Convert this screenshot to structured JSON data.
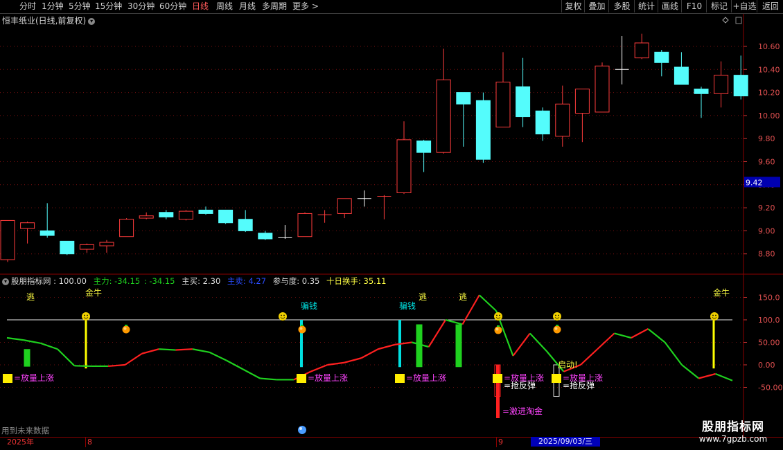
{
  "toolbar": {
    "left": [
      "分时",
      "1分钟",
      "5分钟",
      "15分钟",
      "30分钟",
      "60分钟",
      "日线",
      "周线",
      "月线",
      "多周期",
      "更多"
    ],
    "active": "日线",
    "more_arrow": ">",
    "right": [
      "复权",
      "叠加",
      "多股",
      "统计",
      "画线",
      "F10",
      "标记",
      "+自选",
      "返回"
    ]
  },
  "window": {
    "title": "恒丰纸业(日线,前复权)",
    "dropdown_icon": "chevron-down-icon",
    "diamond_icon": "diamond-icon"
  },
  "price_axis": {
    "ticks": [
      "10.60",
      "10.40",
      "10.20",
      "10.00",
      "9.80",
      "9.60",
      "9.40",
      "9.20",
      "9.00",
      "8.80"
    ],
    "current": "9.42"
  },
  "candles": [
    {
      "o": 8.75,
      "c": 9.09,
      "h": 9.09,
      "l": 8.73
    },
    {
      "o": 9.02,
      "c": 9.07,
      "h": 9.08,
      "l": 8.89
    },
    {
      "o": 9.0,
      "c": 8.96,
      "h": 9.24,
      "l": 8.94
    },
    {
      "o": 8.91,
      "c": 8.8,
      "h": 8.91,
      "l": 8.79
    },
    {
      "o": 8.84,
      "c": 8.88,
      "h": 8.89,
      "l": 8.81
    },
    {
      "o": 8.87,
      "c": 8.9,
      "h": 8.92,
      "l": 8.81
    },
    {
      "o": 8.95,
      "c": 9.1,
      "h": 9.11,
      "l": 8.95
    },
    {
      "o": 9.11,
      "c": 9.13,
      "h": 9.16,
      "l": 9.1
    },
    {
      "o": 9.16,
      "c": 9.12,
      "h": 9.18,
      "l": 9.1
    },
    {
      "o": 9.1,
      "c": 9.17,
      "h": 9.18,
      "l": 9.09
    },
    {
      "o": 9.18,
      "c": 9.15,
      "h": 9.21,
      "l": 9.14
    },
    {
      "o": 9.18,
      "c": 9.07,
      "h": 9.18,
      "l": 9.06
    },
    {
      "o": 9.1,
      "c": 9.0,
      "h": 9.18,
      "l": 8.99
    },
    {
      "o": 8.98,
      "c": 8.93,
      "h": 9.0,
      "l": 8.92
    },
    {
      "o": 8.94,
      "c": 8.94,
      "h": 9.05,
      "l": 8.93
    },
    {
      "o": 8.95,
      "c": 9.15,
      "h": 9.16,
      "l": 8.95
    },
    {
      "o": 9.14,
      "c": 9.14,
      "h": 9.18,
      "l": 9.07
    },
    {
      "o": 9.15,
      "c": 9.28,
      "h": 9.28,
      "l": 9.11
    },
    {
      "o": 9.28,
      "c": 9.28,
      "h": 9.35,
      "l": 9.21
    },
    {
      "o": 9.3,
      "c": 9.3,
      "h": 9.31,
      "l": 9.1
    },
    {
      "o": 9.33,
      "c": 9.79,
      "h": 9.95,
      "l": 9.32
    },
    {
      "o": 9.78,
      "c": 9.68,
      "h": 9.79,
      "l": 9.51
    },
    {
      "o": 9.68,
      "c": 10.31,
      "h": 10.58,
      "l": 9.67
    },
    {
      "o": 10.2,
      "c": 10.1,
      "h": 10.2,
      "l": 9.73
    },
    {
      "o": 10.13,
      "c": 9.62,
      "h": 10.2,
      "l": 9.59
    },
    {
      "o": 9.9,
      "c": 10.29,
      "h": 10.55,
      "l": 9.9
    },
    {
      "o": 10.25,
      "c": 9.99,
      "h": 10.5,
      "l": 9.9
    },
    {
      "o": 10.04,
      "c": 9.84,
      "h": 10.07,
      "l": 9.78
    },
    {
      "o": 9.82,
      "c": 10.1,
      "h": 10.26,
      "l": 9.73
    },
    {
      "o": 10.02,
      "c": 10.23,
      "h": 10.23,
      "l": 9.77
    },
    {
      "o": 10.03,
      "c": 10.43,
      "h": 10.46,
      "l": 10.03
    },
    {
      "o": 10.4,
      "c": 10.4,
      "h": 10.69,
      "l": 10.27
    },
    {
      "o": 10.5,
      "c": 10.63,
      "h": 10.71,
      "l": 10.49
    },
    {
      "o": 10.55,
      "c": 10.46,
      "h": 10.57,
      "l": 10.34
    },
    {
      "o": 10.42,
      "c": 10.27,
      "h": 10.55,
      "l": 10.27
    },
    {
      "o": 10.23,
      "c": 10.19,
      "h": 10.25,
      "l": 9.98
    },
    {
      "o": 10.19,
      "c": 10.35,
      "h": 10.47,
      "l": 10.07
    },
    {
      "o": 10.35,
      "c": 10.17,
      "h": 10.52,
      "l": 10.14
    }
  ],
  "indicator": {
    "name": "股朋指标网",
    "value": ": 100.00",
    "zhuli": "主力: -34.15",
    "zhuli2": ": -34.15",
    "zhumai": "主买: 2.30",
    "zhumai_sell": "主卖: 4.27",
    "canyu": "参与度: 0.35",
    "huanshou": "十日换手: 35.11",
    "axis": [
      "150.0",
      "100.0",
      "50.00",
      "0.00",
      "-50.00"
    ],
    "line": [
      60,
      55,
      48,
      35,
      -2,
      -3,
      -3,
      0,
      25,
      35,
      33,
      35,
      28,
      10,
      -10,
      -30,
      -33,
      -33,
      -15,
      0,
      5,
      15,
      35,
      45,
      50,
      40,
      100,
      90,
      155,
      120,
      20,
      70,
      30,
      -15,
      0,
      35,
      70,
      60,
      80,
      50,
      0,
      -30,
      -20,
      -35
    ],
    "labels": {
      "tao": "逃",
      "jinniu": "金牛",
      "pianqian": "骗钱",
      "faliang": "=放量上涨",
      "fantan": "=抢反弹",
      "taojin": "=激进淘金",
      "qidong": "启动!"
    },
    "future_note": "用到未来数据"
  },
  "dates": {
    "year": "2025年",
    "m8": "8",
    "m9": "9",
    "current": "2025/09/03/三"
  },
  "watermark": {
    "title": "股朋指标网",
    "url": "www.7gpzb.com"
  },
  "colors": {
    "up": "#ff3c3c",
    "down": "#54fcfc",
    "green": "#1fd11f",
    "yellow": "#ffff00",
    "magenta": "#ff44ff",
    "cyan": "#00e0e0"
  }
}
